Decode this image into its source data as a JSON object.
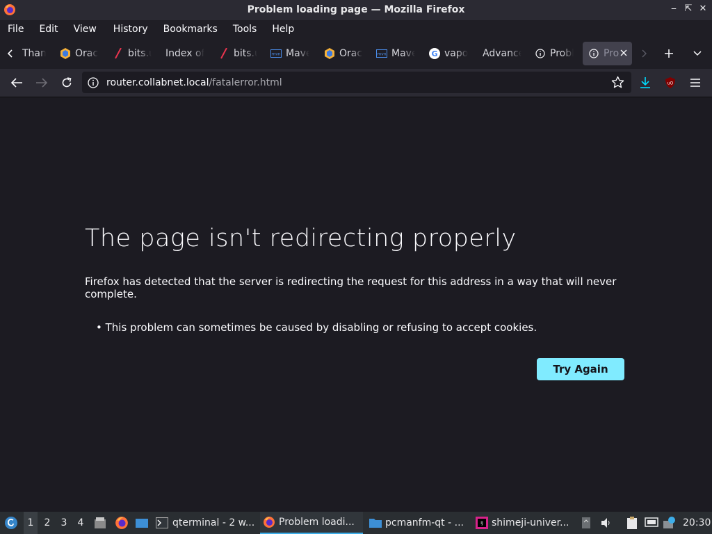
{
  "window": {
    "title": "Problem loading page — Mozilla Firefox",
    "controls": [
      "minimize",
      "restore",
      "close"
    ]
  },
  "menubar": {
    "items": [
      "File",
      "Edit",
      "View",
      "History",
      "Bookmarks",
      "Tools",
      "Help"
    ]
  },
  "tabs": {
    "items": [
      {
        "label": "Thanks",
        "icon": "none"
      },
      {
        "label": "Oracle",
        "icon": "oracle-icon"
      },
      {
        "label": "bits.u",
        "icon": "pen-icon"
      },
      {
        "label": "Index of",
        "icon": "none"
      },
      {
        "label": "bits.u",
        "icon": "pen-icon"
      },
      {
        "label": "Maven",
        "icon": "maven-icon"
      },
      {
        "label": "Oracle",
        "icon": "oracle-icon"
      },
      {
        "label": "Maven",
        "icon": "maven-icon"
      },
      {
        "label": "vapo",
        "icon": "google-icon"
      },
      {
        "label": "Advanced",
        "icon": "none"
      },
      {
        "label": "Problem",
        "icon": "info-icon"
      },
      {
        "label": "Pro",
        "icon": "info-icon",
        "active": true
      }
    ]
  },
  "navbar": {
    "url_host": "router.collabnet.local",
    "url_path": "/fatalerror.html"
  },
  "error": {
    "title": "The page isn't redirecting properly",
    "description": "Firefox has detected that the server is redirecting the request for this address in a way that will never complete.",
    "bullets": [
      "This problem can sometimes be caused by disabling or refusing to accept cookies."
    ],
    "button": "Try Again"
  },
  "taskbar": {
    "desktops": [
      "1",
      "2",
      "3",
      "4"
    ],
    "tasks": [
      {
        "label": "qterminal - 2 w..."
      },
      {
        "label": "Problem loadi...",
        "active": true
      },
      {
        "label": "pcmanfm-qt - ..."
      },
      {
        "label": "shimeji-univer..."
      }
    ],
    "clock": "20:30"
  },
  "colors": {
    "accent": "#80ebff",
    "page_bg": "#1c1b22",
    "chrome_bg": "#2b2a33"
  }
}
